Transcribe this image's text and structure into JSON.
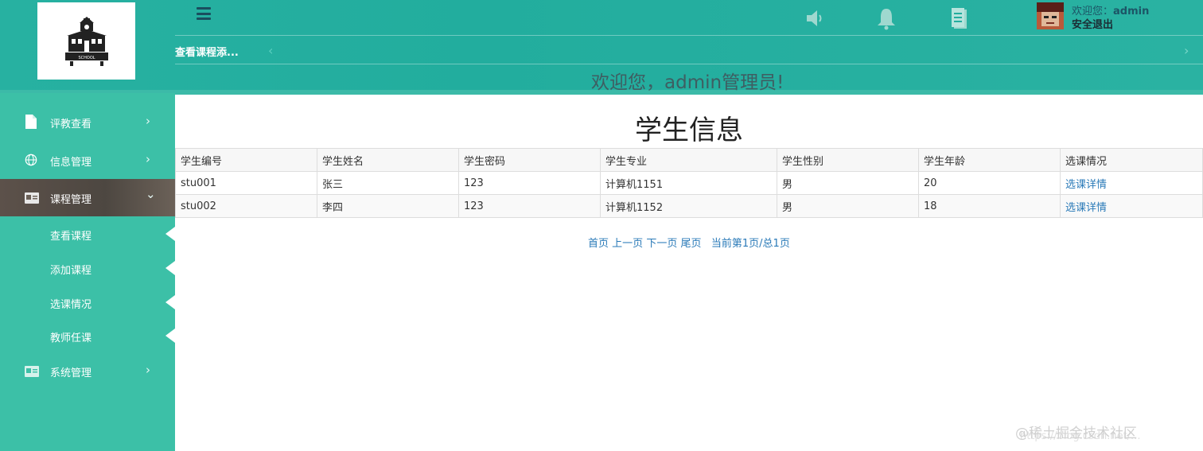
{
  "header": {
    "logo_text": "SCHOOL",
    "welcome_prefix": "欢迎您：",
    "username": "admin",
    "logout_label": "安全退出",
    "active_tab_label": "查看课程添...",
    "prev_arrow": "‹",
    "next_arrow": "›",
    "banner_text": "欢迎您，admin管理员!",
    "icons": [
      "menu-icon",
      "speaker-icon",
      "bell-icon",
      "clipboard-icon"
    ]
  },
  "sidebar": {
    "items": [
      {
        "label": "评教查看",
        "icon": "file-icon",
        "chevron": "›"
      },
      {
        "label": "信息管理",
        "icon": "globe-icon",
        "chevron": "›"
      },
      {
        "label": "课程管理",
        "icon": "id-card-icon",
        "chevron": "⌄"
      },
      {
        "label": "系统管理",
        "icon": "id-card-icon",
        "chevron": "›"
      }
    ],
    "subitems": [
      {
        "label": "查看课程"
      },
      {
        "label": "添加课程"
      },
      {
        "label": "选课情况"
      },
      {
        "label": "教师任课"
      }
    ]
  },
  "main": {
    "title": "学生信息",
    "columns": [
      "学生编号",
      "学生姓名",
      "学生密码",
      "学生专业",
      "学生性别",
      "学生年龄",
      "选课情况"
    ],
    "rows": [
      {
        "id": "stu001",
        "name": "张三",
        "password": "123",
        "major": "计算机1151",
        "gender": "男",
        "age": "20",
        "detail": "选课详情"
      },
      {
        "id": "stu002",
        "name": "李四",
        "password": "123",
        "major": "计算机1152",
        "gender": "男",
        "age": "18",
        "detail": "选课详情"
      }
    ],
    "pager": {
      "first": "首页",
      "prev": "上一页",
      "next": "下一页",
      "last": "尾页",
      "status": "当前第1页/总1页"
    }
  },
  "watermark": {
    "text": "@稀土掘金技术社区",
    "url": "https://blog.csdn.net/..."
  },
  "colors": {
    "header": "#22ad9e",
    "sidebar": "#3cc0a7",
    "active_item": "#4d4741",
    "link": "#2a7ab8"
  }
}
